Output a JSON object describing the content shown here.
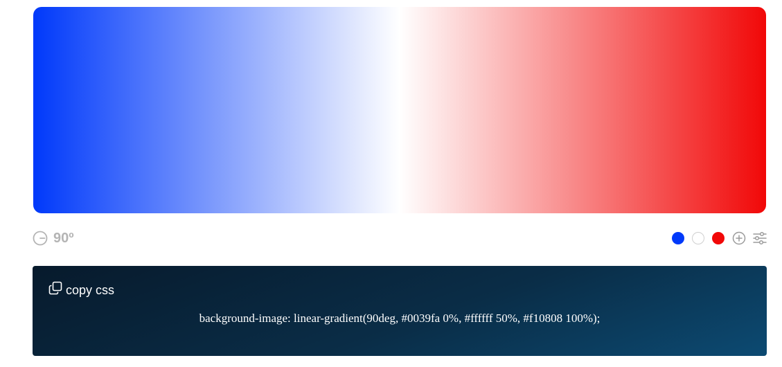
{
  "gradient": {
    "angle_deg": 90,
    "stops": [
      {
        "color": "#0039fa",
        "position_pct": 0
      },
      {
        "color": "#ffffff",
        "position_pct": 50
      },
      {
        "color": "#f10808",
        "position_pct": 100
      }
    ]
  },
  "controls": {
    "angle_label": "90º",
    "angle_icon": "angle-dial-icon",
    "add_icon": "plus-circle-icon",
    "settings_icon": "sliders-icon"
  },
  "code_panel": {
    "copy_label": "copy css",
    "copy_icon": "copy-icon",
    "css_text": "background-image: linear-gradient(90deg, #0039fa 0%, #ffffff 50%, #f10808 100%);"
  }
}
